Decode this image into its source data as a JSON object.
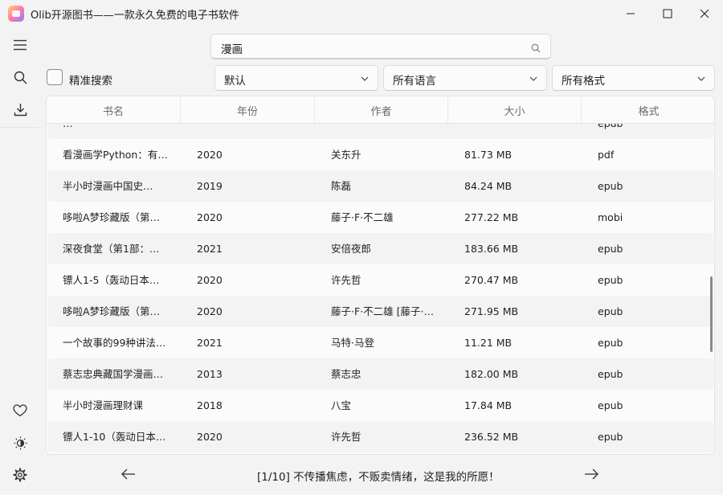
{
  "window": {
    "title": "Olib开源图书——一款永久免费的电子书软件",
    "app_icon": "olib-app-icon",
    "controls": [
      "minimize-icon",
      "maximize-icon",
      "close-icon"
    ]
  },
  "sidebar": {
    "top_items": [
      "menu-icon",
      "search-icon",
      "download-icon"
    ],
    "bottom_items": [
      "heart-icon",
      "theme-toggle-icon",
      "settings-icon"
    ]
  },
  "search": {
    "value": "漫画",
    "icon": "search-icon"
  },
  "filters": {
    "exact_search_label": "精准搜索",
    "exact_search_checked": false,
    "sort": "默认",
    "language": "所有语言",
    "format": "所有格式"
  },
  "table": {
    "columns": [
      "书名",
      "年份",
      "作者",
      "大小",
      "格式"
    ],
    "rows": [
      {
        "title": "…",
        "year": "",
        "author": "",
        "size": "",
        "format": "epub"
      },
      {
        "title": "看漫画学Python：有…",
        "year": "2020",
        "author": "关东升",
        "size": "81.73 MB",
        "format": "pdf"
      },
      {
        "title": "半小时漫画中国史…",
        "year": "2019",
        "author": "陈磊",
        "size": "84.24 MB",
        "format": "epub"
      },
      {
        "title": "哆啦A梦珍藏版（第…",
        "year": "2020",
        "author": "藤子·F·不二雄",
        "size": "277.22 MB",
        "format": "mobi"
      },
      {
        "title": "深夜食堂（第1部：…",
        "year": "2021",
        "author": "安倍夜郎",
        "size": "183.66 MB",
        "format": "epub"
      },
      {
        "title": "镖人1-5（轰动日本…",
        "year": "2020",
        "author": "许先哲",
        "size": "270.47 MB",
        "format": "epub"
      },
      {
        "title": "哆啦A梦珍藏版（第…",
        "year": "2020",
        "author": "藤子·F·不二雄 [藤子·…",
        "size": "271.95 MB",
        "format": "epub"
      },
      {
        "title": "一个故事的99种讲法…",
        "year": "2021",
        "author": "马特·马登",
        "size": "11.21 MB",
        "format": "epub"
      },
      {
        "title": "蔡志忠典藏国学漫画…",
        "year": "2013",
        "author": "蔡志忠",
        "size": "182.00 MB",
        "format": "epub"
      },
      {
        "title": "半小时漫画理财课",
        "year": "2018",
        "author": "八宝",
        "size": "17.84 MB",
        "format": "epub"
      },
      {
        "title": "镖人1-10（轰动日本…",
        "year": "2020",
        "author": "许先哲",
        "size": "236.52 MB",
        "format": "epub"
      }
    ]
  },
  "footer": {
    "text": "[1/10] 不传播焦虑，不贩卖情绪，这是我的所愿！",
    "prev_icon": "arrow-left-icon",
    "next_icon": "arrow-right-icon"
  }
}
